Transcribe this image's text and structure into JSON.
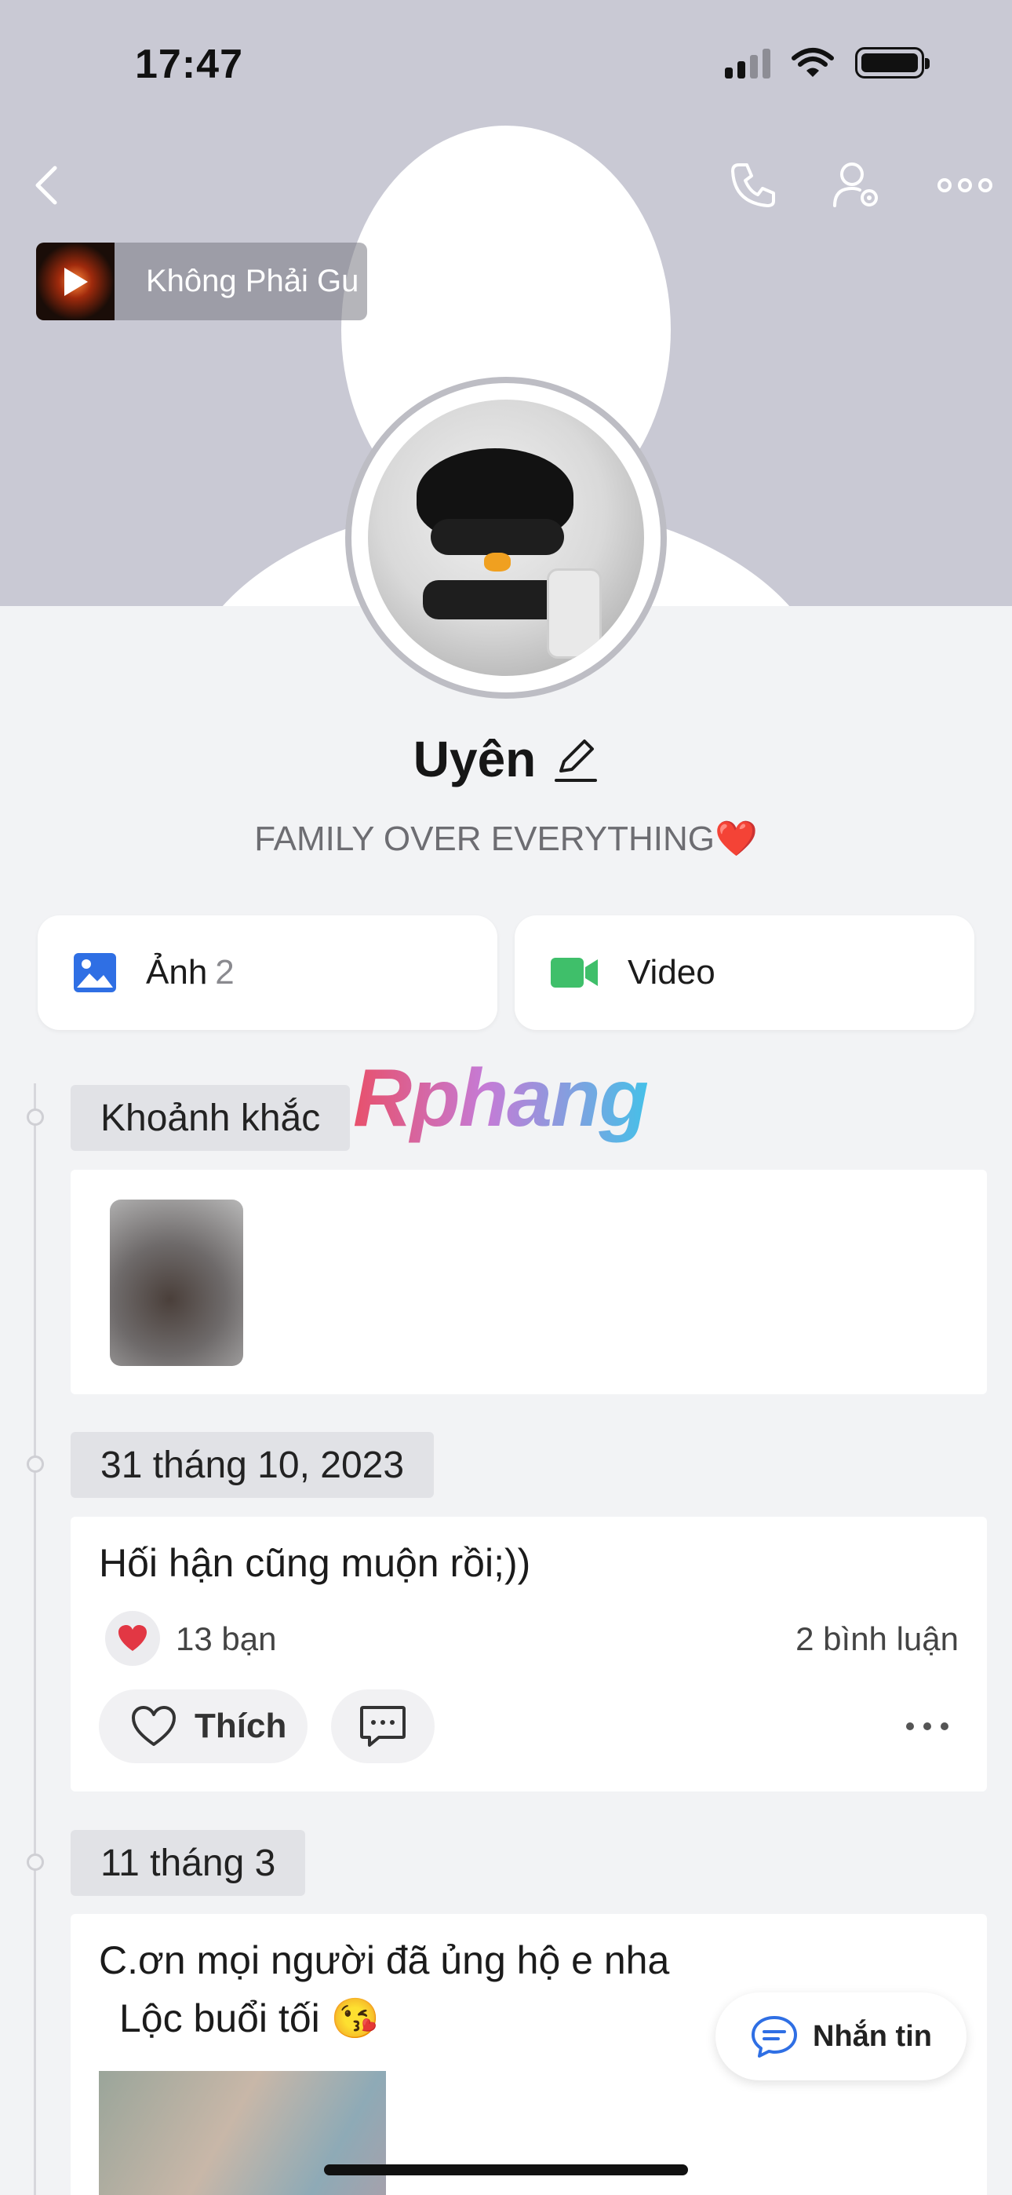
{
  "status_bar": {
    "time": "17:47"
  },
  "now_playing": {
    "title": "Không Phải Gu"
  },
  "profile": {
    "name": "Uyên",
    "bio": "FAMILY OVER EVERYTHING❤️"
  },
  "media_tabs": {
    "photos_label": "Ảnh",
    "photos_count": "2",
    "video_label": "Video"
  },
  "watermark": "Rphang",
  "timeline": {
    "moments_label": "Khoảnh khắc",
    "posts": [
      {
        "date": "31 tháng 10, 2023",
        "text": "Hối hận cũng muộn rồi;))",
        "reactions": "13 bạn",
        "comments": "2 bình luận",
        "like_label": "Thích"
      },
      {
        "date": "11 tháng 3",
        "text_line1": "C.ơn mọi người đã ủng hộ e nha",
        "text_line2": "Lộc buổi tối 😘"
      }
    ]
  },
  "message_button": {
    "label": "Nhắn tin"
  },
  "colors": {
    "cover": "#c9c9d4",
    "page_bg": "#f2f3f5",
    "photo_icon": "#2f6fe4",
    "video_icon": "#3fbf6a",
    "heart": "#e23744",
    "message_icon": "#2f6fe4"
  }
}
